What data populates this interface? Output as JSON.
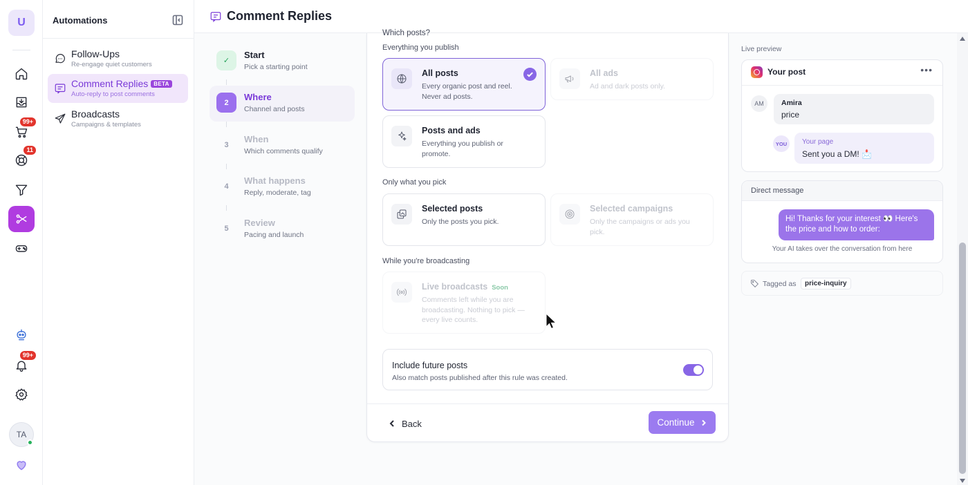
{
  "rail": {
    "logo_letter": "U",
    "badges": {
      "cart": "99+",
      "support": "11",
      "notifications": "99+"
    },
    "avatar_initials": "TA"
  },
  "sidebar": {
    "title": "Automations",
    "items": [
      {
        "label": "Follow-Ups",
        "sub": "Re-engage quiet customers",
        "icon": "message-circle-icon"
      },
      {
        "label": "Comment Replies",
        "sub": "Auto-reply to post comments",
        "badge": "BETA",
        "icon": "comment-icon",
        "active": true
      },
      {
        "label": "Broadcasts",
        "sub": "Campaigns & templates",
        "icon": "send-icon"
      }
    ]
  },
  "header": {
    "title": "Comment Replies"
  },
  "steps": [
    {
      "num": "✓",
      "title": "Start",
      "sub": "Pick a starting point",
      "state": "done"
    },
    {
      "num": "2",
      "title": "Where",
      "sub": "Channel and posts",
      "state": "active"
    },
    {
      "num": "3",
      "title": "When",
      "sub": "Which comments qualify",
      "state": "pending"
    },
    {
      "num": "4",
      "title": "What happens",
      "sub": "Reply, moderate, tag",
      "state": "pending"
    },
    {
      "num": "5",
      "title": "Review",
      "sub": "Pacing and launch",
      "state": "pending"
    }
  ],
  "form": {
    "cut_heading": "Which posts?",
    "sections": {
      "everything": "Everything you publish",
      "pick": "Only what you pick",
      "broadcasting": "While you're broadcasting"
    },
    "options": {
      "all_posts": {
        "title": "All posts",
        "desc": "Every organic post and reel. Never ad posts."
      },
      "all_ads": {
        "title": "All ads",
        "desc": "Ad and dark posts only."
      },
      "posts_and_ads": {
        "title": "Posts and ads",
        "desc": "Everything you publish or promote."
      },
      "selected_posts": {
        "title": "Selected posts",
        "desc": "Only the posts you pick."
      },
      "selected_campaigns": {
        "title": "Selected campaigns",
        "desc": "Only the campaigns or ads you pick."
      },
      "live_broadcasts": {
        "title": "Live broadcasts",
        "badge": "Soon",
        "desc": "Comments left while you are broadcasting. Nothing to pick — every live counts."
      }
    },
    "future": {
      "title": "Include future posts",
      "desc": "Also match posts published after this rule was created.",
      "enabled": true
    },
    "back_label": "Back",
    "continue_label": "Continue"
  },
  "preview": {
    "label": "Live preview",
    "post_title": "Your post",
    "comment": {
      "avatar": "AM",
      "author": "Amira",
      "text": "price"
    },
    "reply": {
      "avatar": "YOU",
      "author": "Your page",
      "text": "Sent you a DM! 📩"
    },
    "dm_header": "Direct message",
    "dm_text": "Hi! Thanks for your interest 👀 Here's the price and how to order:",
    "dm_note": "Your AI takes over the conversation from here",
    "tag_label": "Tagged as",
    "tag_value": "price-inquiry"
  },
  "colors": {
    "accent": "#8866e6",
    "active_nav": "#b03ce0",
    "badge": "#e2342c"
  }
}
